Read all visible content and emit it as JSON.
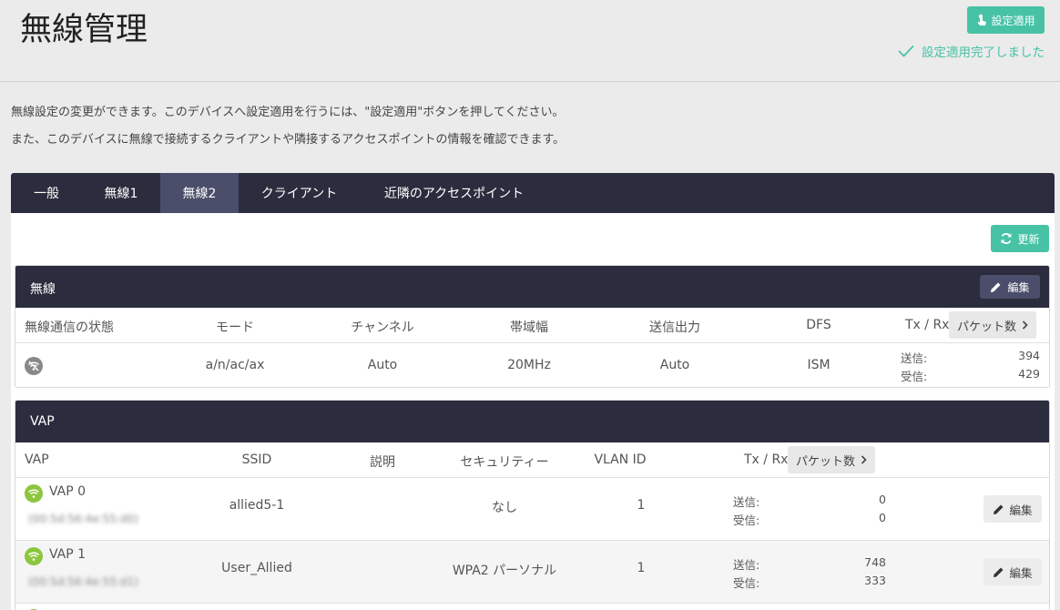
{
  "page": {
    "title": "無線管理",
    "apply_button": "設定適用",
    "apply_status": "設定適用完了しました",
    "description_line1": "無線設定の変更ができます。このデバイスへ設定適用を行うには、\"設定適用\"ボタンを押してください。",
    "description_line2": "また、このデバイスに無線で接続するクライアントや隣接するアクセスポイントの情報を確認できます。"
  },
  "tabs": [
    {
      "label": "一般",
      "active": false
    },
    {
      "label": "無線1",
      "active": false
    },
    {
      "label": "無線2",
      "active": true
    },
    {
      "label": "クライアント",
      "active": false
    },
    {
      "label": "近隣のアクセスポイント",
      "active": false
    }
  ],
  "refresh_button": "更新",
  "radio_panel": {
    "title": "無線",
    "edit_button": "編集",
    "headers": {
      "status": "無線通信の状態",
      "mode": "モード",
      "channel": "チャンネル",
      "bandwidth": "帯域幅",
      "power": "送信出力",
      "dfs": "DFS",
      "txrx": "Tx / Rx",
      "packet_button": "パケット数"
    },
    "row": {
      "mode": "a/n/ac/ax",
      "channel": "Auto",
      "bandwidth": "20MHz",
      "power": "Auto",
      "dfs": "ISM",
      "tx_label": "送信:",
      "tx_value": "394",
      "rx_label": "受信:",
      "rx_value": "429"
    }
  },
  "vap_panel": {
    "title": "VAP",
    "headers": {
      "vap": "VAP",
      "ssid": "SSID",
      "description": "説明",
      "security": "セキュリティー",
      "vlan": "VLAN ID",
      "txrx": "Tx / Rx",
      "packet_button": "パケット数"
    },
    "rows": [
      {
        "name": "VAP 0",
        "mac": "(00:5d:56:4e:55:d0)",
        "ssid": "allied5-1",
        "description": "",
        "security": "なし",
        "vlan": "1",
        "tx_label": "送信:",
        "tx_value": "0",
        "rx_label": "受信:",
        "rx_value": "0",
        "edit": "編集"
      },
      {
        "name": "VAP 1",
        "mac": "(00:5d:56:4e:55:d1)",
        "ssid": "User_Allied",
        "description": "",
        "security": "WPA2 パーソナル",
        "vlan": "1",
        "tx_label": "送信:",
        "tx_value": "748",
        "rx_label": "受信:",
        "rx_value": "333",
        "edit": "編集"
      }
    ]
  },
  "colors": {
    "accent": "#48c2a5",
    "dark": "#2b2d3e",
    "tab_active": "#4b4e6a",
    "wifi_on": "#8cc63f"
  }
}
